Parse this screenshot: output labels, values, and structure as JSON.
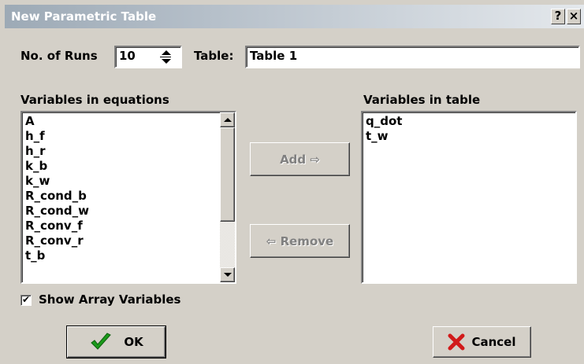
{
  "window": {
    "title": "New Parametric Table",
    "help_label": "?",
    "close_label": "×"
  },
  "runs": {
    "label": "No. of Runs",
    "value": "10"
  },
  "table": {
    "label": "Table:",
    "value": "Table 1"
  },
  "equations_list": {
    "header": "Variables in equations",
    "items": [
      "A",
      "h_f",
      "h_r",
      "k_b",
      "k_w",
      "R_cond_b",
      "R_cond_w",
      "R_conv_f",
      "R_conv_r",
      "t_b"
    ]
  },
  "table_list": {
    "header": "Variables in table",
    "items": [
      "q_dot",
      "t_w"
    ]
  },
  "buttons": {
    "add_label": "Add ⇨",
    "remove_label": "⇦ Remove",
    "ok_label": "OK",
    "cancel_label": "Cancel"
  },
  "show_array": {
    "label": "Show Array Variables",
    "checked": true
  },
  "colors": {
    "ok_icon": "#1a9a1a",
    "cancel_icon": "#d11a1a",
    "dialog_bg": "#d4d0c8"
  }
}
